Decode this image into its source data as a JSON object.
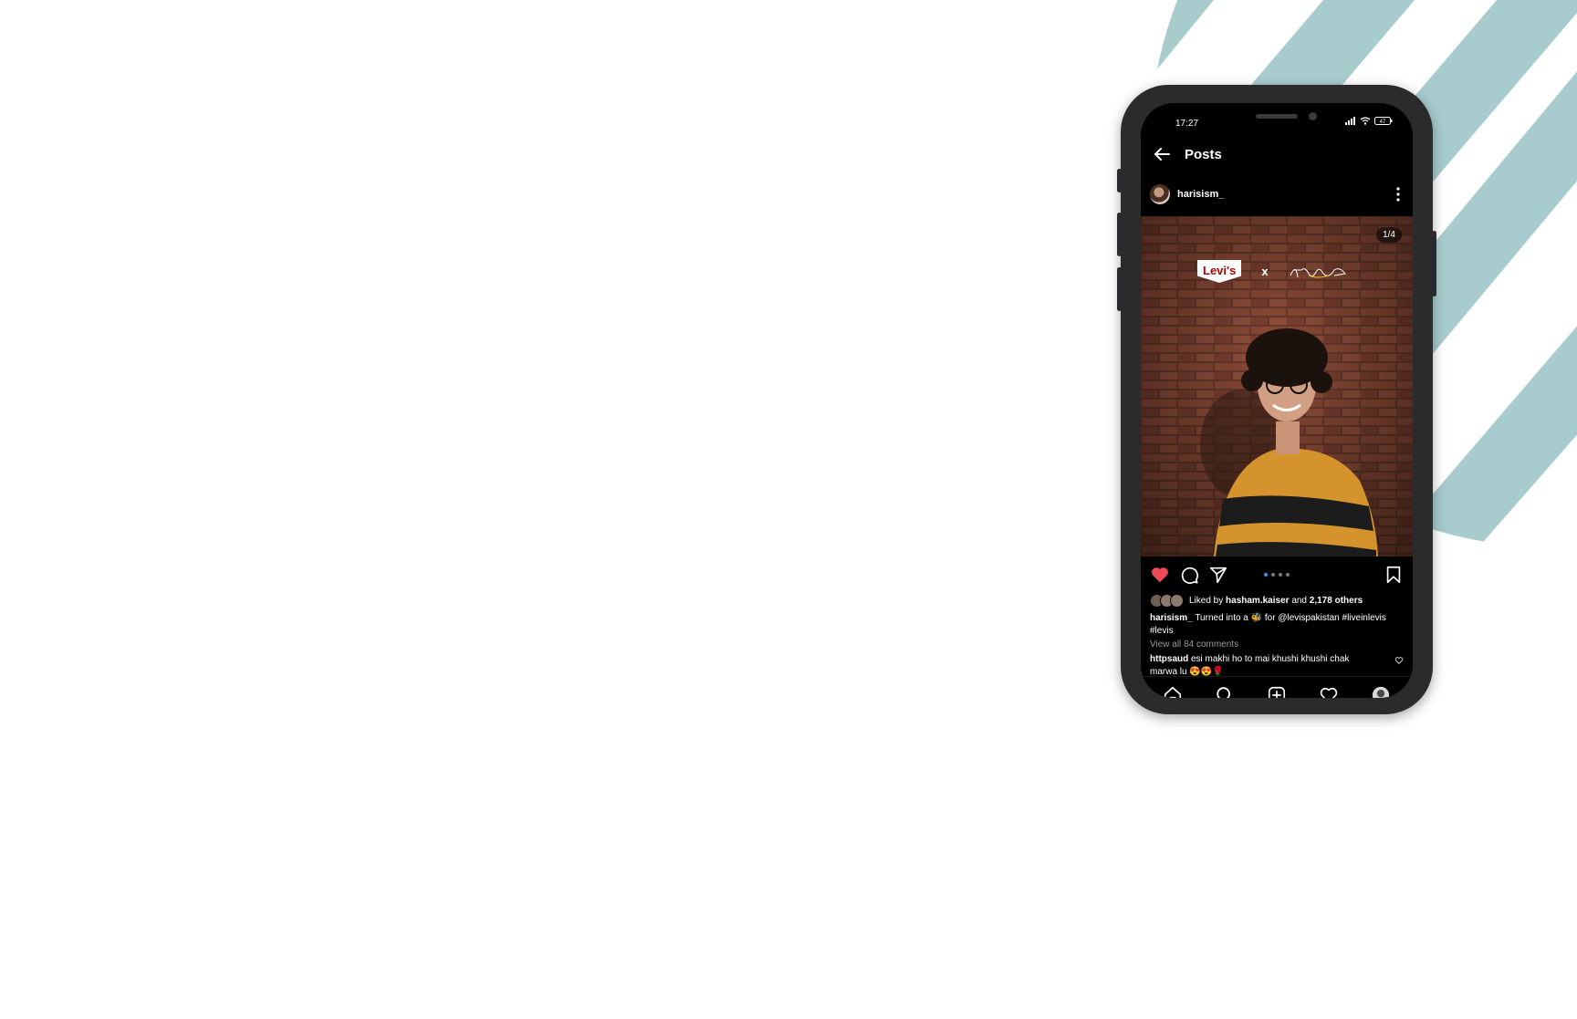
{
  "colors": {
    "background": "#ffffff",
    "decor_teal": "#a8cccd",
    "screen": "#000000",
    "like_red": "#ed4956",
    "active_dot": "#3897f0"
  },
  "status_bar": {
    "time": "17:27",
    "battery": "47"
  },
  "app_bar": {
    "back_icon": "arrow-left-icon",
    "title": "Posts"
  },
  "post": {
    "username": "harisism_",
    "more_icon": "vertical-dots-icon",
    "photo": {
      "counter": "1/4",
      "brand_logo": "Levi's",
      "separator": "x",
      "signature_logo": "Harisism"
    },
    "actions": {
      "like_icon": "heart-filled-icon",
      "comment_icon": "comment-icon",
      "share_icon": "send-icon",
      "save_icon": "bookmark-icon",
      "carousel_position": 1,
      "carousel_count": 4
    },
    "likes": {
      "prefix": "Liked by",
      "user": "hasham.kaiser",
      "joiner": "and",
      "others": "2,178 others"
    },
    "caption": {
      "user": "harisism_",
      "text": "Turned into a 🐝 for @levispakistan #liveinlevis #levis"
    },
    "view_comments": "View all 84 comments",
    "top_comment": {
      "user": "httpsaud",
      "text": "esi makhi ho to mai khushi khushi chak marwa lu 😍😍🌹"
    }
  },
  "tab_bar": {
    "items": [
      "home-icon",
      "search-icon",
      "add-post-icon",
      "activity-heart-icon",
      "profile-avatar-icon"
    ]
  }
}
